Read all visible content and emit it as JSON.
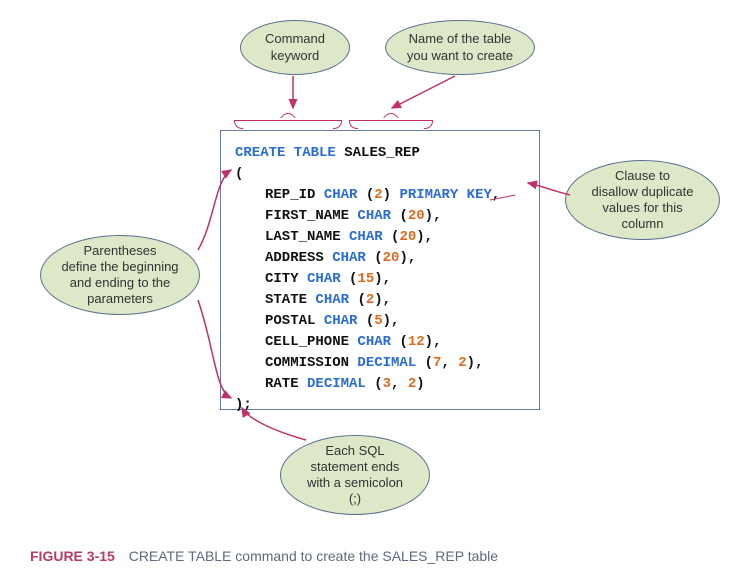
{
  "callouts": {
    "command_keyword": "Command\nkeyword",
    "table_name": "Name of the table\nyou want to create",
    "parentheses": "Parentheses\ndefine the beginning\nand ending to the\nparameters",
    "primary_key": "Clause to\ndisallow duplicate\nvalues for this\ncolumn",
    "semicolon": "Each SQL\nstatement ends\nwith a semicolon\n(;)"
  },
  "code": {
    "line1_create_table": "CREATE TABLE",
    "line1_table_name": "SALES_REP",
    "open_paren": "(",
    "rows": [
      {
        "name": "REP_ID",
        "type": "CHAR",
        "size": "(2)",
        "extra_kw": "PRIMARY KEY",
        "tail": ","
      },
      {
        "name": "FIRST_NAME",
        "type": "CHAR",
        "size": "(20)",
        "tail": ","
      },
      {
        "name": "LAST_NAME",
        "type": "CHAR",
        "size": "(20)",
        "tail": ","
      },
      {
        "name": "ADDRESS",
        "type": "CHAR",
        "size": "(20)",
        "tail": ","
      },
      {
        "name": "CITY",
        "type": "CHAR",
        "size": "(15)",
        "tail": ","
      },
      {
        "name": "STATE",
        "type": "CHAR",
        "size": "(2)",
        "tail": ","
      },
      {
        "name": "POSTAL",
        "type": "CHAR",
        "size": "(5)",
        "tail": ","
      },
      {
        "name": "CELL_PHONE",
        "type": "CHAR",
        "size": "(12)",
        "tail": ","
      },
      {
        "name": "COMMISSION",
        "type": "DECIMAL",
        "size": "(7, 2)",
        "tail": ","
      },
      {
        "name": "RATE",
        "type": "DECIMAL",
        "size": "(3, 2)",
        "tail": ""
      }
    ],
    "close": ");"
  },
  "caption": {
    "fignum": "FIGURE 3-15",
    "text": "CREATE TABLE command to create the SALES_REP table"
  },
  "colors": {
    "arrow": "#c22f6a",
    "callout_fill": "#dce8c8",
    "callout_border": "#5b6e90"
  }
}
